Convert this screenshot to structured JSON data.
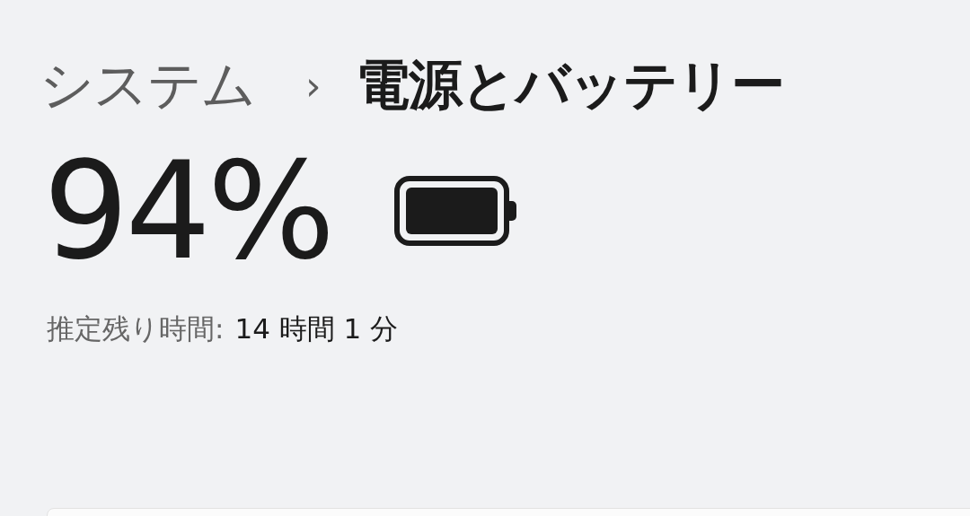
{
  "breadcrumb": {
    "parent": "システム",
    "separator": "›",
    "title": "電源とバッテリー"
  },
  "battery": {
    "percent": "94%"
  },
  "remaining": {
    "label": "推定残り時間:",
    "value": "14 時間 1 分"
  }
}
